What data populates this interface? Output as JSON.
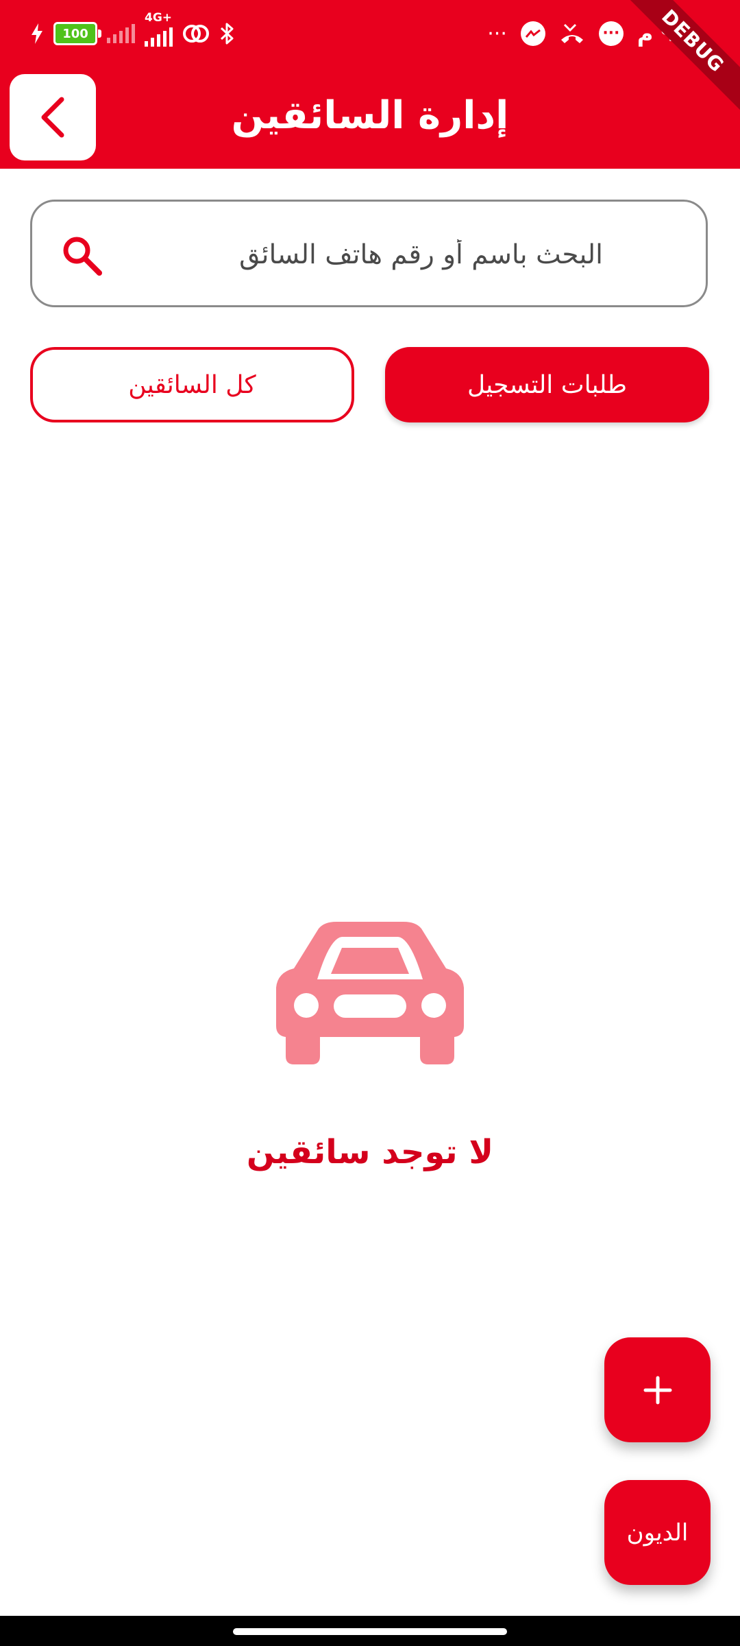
{
  "status_bar": {
    "battery_level": "100",
    "network_type": "4G+",
    "time": "٩ م",
    "overflow_dots": "···",
    "debug_label": "DEBUG",
    "icons": [
      "charging-bolt-icon",
      "battery-icon",
      "signal-icon",
      "mobile-data-icon",
      "hotspot-icon",
      "bluetooth-icon",
      "messenger-icon",
      "missed-call-icon",
      "chat-icon"
    ]
  },
  "header": {
    "title": "إدارة السائقين",
    "back_icon": "chevron-left-icon",
    "background_color": "#e8001e"
  },
  "search": {
    "placeholder": "البحث باسم أو رقم هاتف السائق",
    "value": "",
    "icon": "search-icon"
  },
  "tabs": [
    {
      "label": "طلبات التسجيل",
      "active": true
    },
    {
      "label": "كل السائقين",
      "active": false
    }
  ],
  "empty_state": {
    "icon": "car-icon",
    "message": "لا توجد سائقين"
  },
  "fabs": {
    "add_label": "+",
    "debts_label": "الديون"
  },
  "colors": {
    "accent": "#e8001e",
    "empty_icon": "#f5838f",
    "empty_text": "#d4001c"
  }
}
